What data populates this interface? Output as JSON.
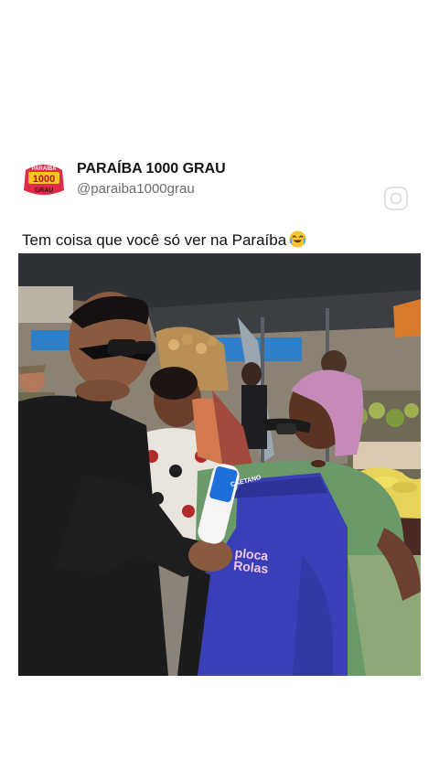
{
  "post": {
    "account_name": "PARAÍBA 1000 GRAU",
    "account_handle": "@paraiba1000grau",
    "caption": "Tem coisa que você só ver na Paraíba",
    "caption_emoji": "laughing-crying-emoji",
    "avatar_text": [
      "PARAÍBA",
      "1000",
      "GRAU"
    ]
  },
  "video": {
    "mic_label": [
      "CAETANO"
    ],
    "apron_label": [
      "ploca",
      "Rolas"
    ]
  },
  "colors": {
    "awning": "#2e3236",
    "apron": "#3a3fb8",
    "headscarf": "#c58ab8",
    "shirt_black": "#1b1b1d",
    "mic_blue": "#1e6fd9"
  }
}
